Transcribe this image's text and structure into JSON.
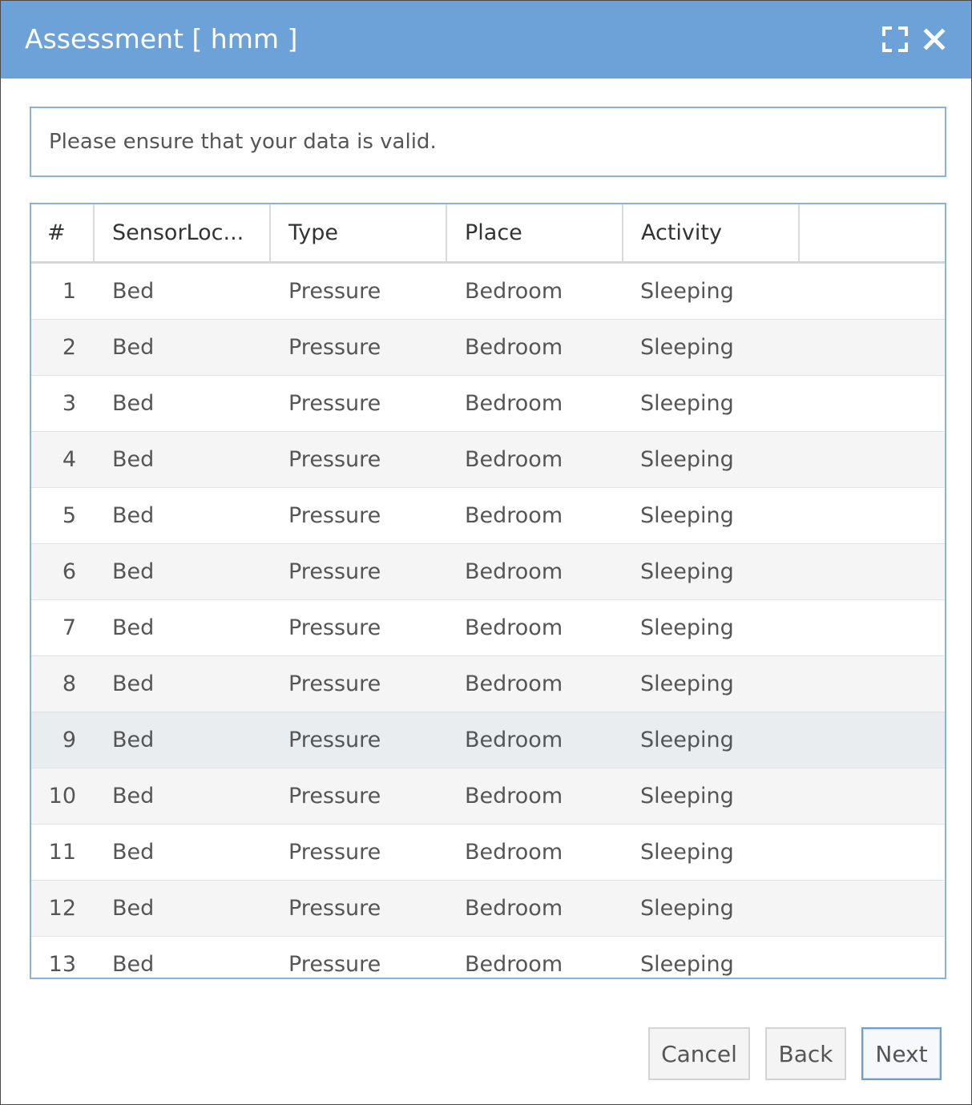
{
  "dialog": {
    "title": "Assessment [ hmm ]",
    "maximize_icon": "maximize-icon",
    "close_icon": "close-icon",
    "titlebar_color": "#6ca2d8"
  },
  "message": {
    "text": "Please ensure that your data is valid."
  },
  "grid": {
    "columns": [
      "#",
      "SensorLoc...",
      "Type",
      "Place",
      "Activity",
      ""
    ],
    "selected_row": 9,
    "rows": [
      {
        "num": "1",
        "sensor_location": "Bed",
        "type": "Pressure",
        "place": "Bedroom",
        "activity": "Sleeping"
      },
      {
        "num": "2",
        "sensor_location": "Bed",
        "type": "Pressure",
        "place": "Bedroom",
        "activity": "Sleeping"
      },
      {
        "num": "3",
        "sensor_location": "Bed",
        "type": "Pressure",
        "place": "Bedroom",
        "activity": "Sleeping"
      },
      {
        "num": "4",
        "sensor_location": "Bed",
        "type": "Pressure",
        "place": "Bedroom",
        "activity": "Sleeping"
      },
      {
        "num": "5",
        "sensor_location": "Bed",
        "type": "Pressure",
        "place": "Bedroom",
        "activity": "Sleeping"
      },
      {
        "num": "6",
        "sensor_location": "Bed",
        "type": "Pressure",
        "place": "Bedroom",
        "activity": "Sleeping"
      },
      {
        "num": "7",
        "sensor_location": "Bed",
        "type": "Pressure",
        "place": "Bedroom",
        "activity": "Sleeping"
      },
      {
        "num": "8",
        "sensor_location": "Bed",
        "type": "Pressure",
        "place": "Bedroom",
        "activity": "Sleeping"
      },
      {
        "num": "9",
        "sensor_location": "Bed",
        "type": "Pressure",
        "place": "Bedroom",
        "activity": "Sleeping"
      },
      {
        "num": "10",
        "sensor_location": "Bed",
        "type": "Pressure",
        "place": "Bedroom",
        "activity": "Sleeping"
      },
      {
        "num": "11",
        "sensor_location": "Bed",
        "type": "Pressure",
        "place": "Bedroom",
        "activity": "Sleeping"
      },
      {
        "num": "12",
        "sensor_location": "Bed",
        "type": "Pressure",
        "place": "Bedroom",
        "activity": "Sleeping"
      },
      {
        "num": "13",
        "sensor_location": "Bed",
        "type": "Pressure",
        "place": "Bedroom",
        "activity": "Sleeping"
      }
    ]
  },
  "buttons": {
    "cancel": "Cancel",
    "back": "Back",
    "next": "Next"
  }
}
